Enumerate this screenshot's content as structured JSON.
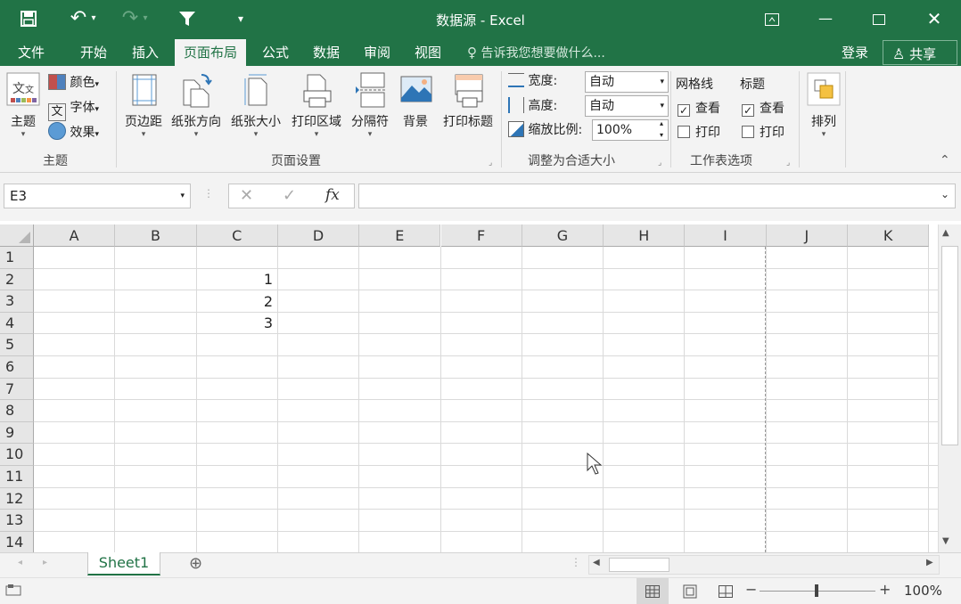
{
  "window": {
    "title": "数据源 - Excel",
    "qa_undo_icon": "↶",
    "qa_redo_icon": "↷",
    "qa_filter_icon": "▼",
    "qa_customize_icon": "⏷"
  },
  "tabs": {
    "file": "文件",
    "home": "开始",
    "insert": "插入",
    "page_layout": "页面布局",
    "formulas": "公式",
    "data": "数据",
    "review": "审阅",
    "view": "视图",
    "tell_me": "告诉我您想要做什么...",
    "sign_in": "登录",
    "share": "共享"
  },
  "ribbon": {
    "themes": {
      "theme_label": "主题",
      "colors": "颜色",
      "fonts": "字体",
      "effects": "效果",
      "group_label": "主题"
    },
    "page_setup": {
      "margins": "页边距",
      "orientation": "纸张方向",
      "size": "纸张大小",
      "print_area": "打印区域",
      "breaks": "分隔符",
      "background": "背景",
      "print_titles": "打印标题",
      "group_label": "页面设置"
    },
    "scale_to_fit": {
      "width_label": "宽度:",
      "width_value": "自动",
      "height_label": "高度:",
      "height_value": "自动",
      "scale_label": "缩放比例:",
      "scale_value": "100%",
      "group_label": "调整为合适大小"
    },
    "sheet_options": {
      "gridlines": "网格线",
      "headings": "标题",
      "view": "查看",
      "print": "打印",
      "group_label": "工作表选项"
    },
    "arrange": {
      "label": "排列"
    }
  },
  "formula_bar": {
    "name_box": "E3",
    "cancel_icon": "✕",
    "enter_icon": "✓",
    "fx_label": "fx",
    "formula": ""
  },
  "grid": {
    "columns": [
      "A",
      "B",
      "C",
      "D",
      "E",
      "F",
      "G",
      "H",
      "I",
      "J",
      "K"
    ],
    "rows": [
      "1",
      "2",
      "3",
      "4",
      "5",
      "6",
      "7",
      "8",
      "9",
      "10",
      "11",
      "12",
      "13",
      "14"
    ],
    "cells": {
      "C2": "1",
      "C3": "2",
      "C4": "3"
    }
  },
  "sheets": {
    "active": "Sheet1",
    "add_icon": "⊕"
  },
  "status": {
    "zoom": "100%",
    "zoom_level": 1.0
  },
  "colors": {
    "accent": "#217346",
    "ribbon_bg": "#f3f3f3",
    "header_bg": "#e6e6e6"
  }
}
